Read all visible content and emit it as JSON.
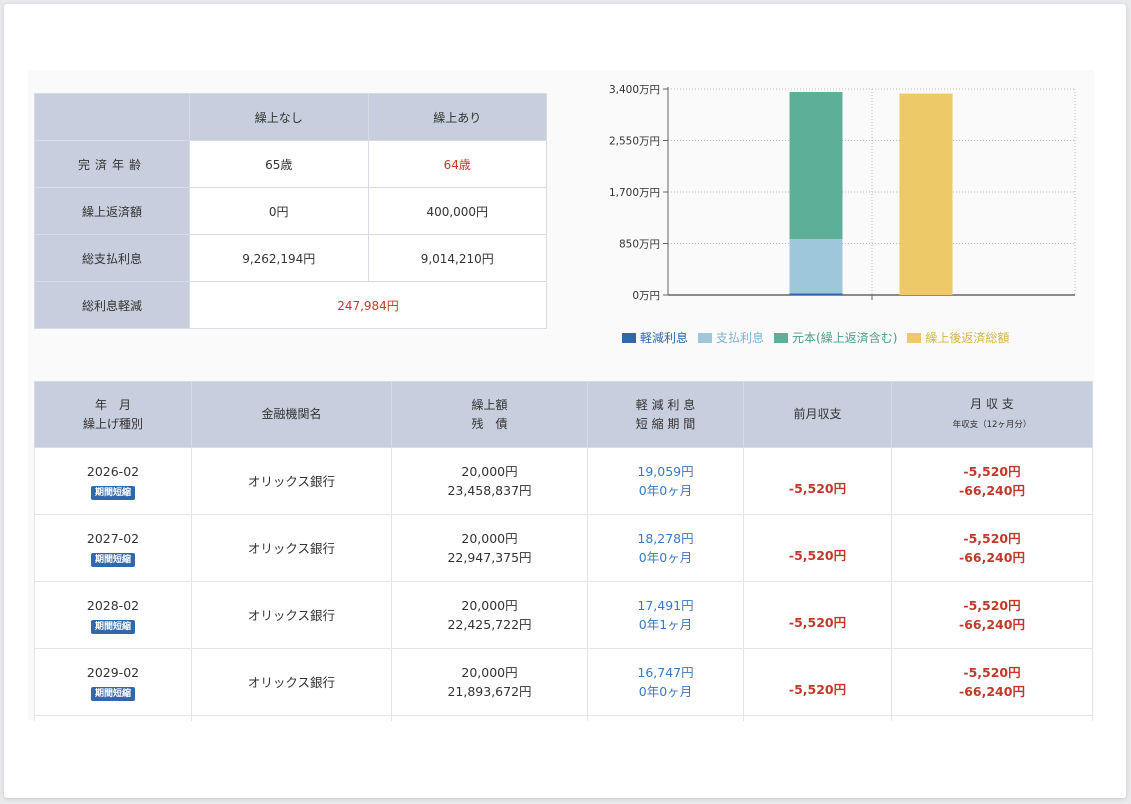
{
  "summary": {
    "col_none": "繰上なし",
    "col_with": "繰上あり",
    "rows": [
      {
        "label": "完済年齢",
        "none": "65歳",
        "with": "64歳"
      },
      {
        "label": "繰上返済額",
        "none": "0円",
        "with": "400,000円"
      },
      {
        "label": "総支払利息",
        "none": "9,262,194円",
        "with": "9,014,210円"
      }
    ],
    "reduction_label": "総利息軽減",
    "reduction_value": "247,984円"
  },
  "chart_data": {
    "type": "bar",
    "stacked": true,
    "categories": [
      "",
      ""
    ],
    "y_ticks": [
      "3,400万円",
      "2,550万円",
      "1,700万円",
      "850万円",
      "0万円"
    ],
    "ylim": [
      0,
      3400
    ],
    "series": [
      {
        "name": "軽減利息",
        "color": "#2f68ad",
        "values": [
          25,
          0
        ]
      },
      {
        "name": "支払利息",
        "color": "#9fc7dc",
        "values": [
          900,
          0
        ]
      },
      {
        "name": "元本(繰上返済含む)",
        "color": "#5daf97",
        "values": [
          2425,
          0
        ]
      },
      {
        "name": "繰上後返済総額",
        "color": "#edc967",
        "values": [
          0,
          3325
        ]
      }
    ],
    "grid": true,
    "legend": "bottom"
  },
  "detail": {
    "headers": {
      "ym_line1": "年　月",
      "ym_line2": "繰上げ種別",
      "bank": "金融機関名",
      "amount_line1": "繰上額",
      "amount_line2": "残　債",
      "interest_line1": "軽 減 利 息",
      "interest_line2": "短 縮 期 間",
      "prev": "前月収支",
      "month_line1": "月 収 支",
      "month_line2": "年収支（12ヶ月分）"
    },
    "rows": [
      {
        "date": "2026-02",
        "type": "期間短縮",
        "bank": "オリックス銀行",
        "amount": "20,000円",
        "balance": "23,458,837円",
        "interest": "19,059円",
        "period": "0年0ヶ月",
        "prev": "-5,520円",
        "month": "-5,520円",
        "year": "-66,240円"
      },
      {
        "date": "2027-02",
        "type": "期間短縮",
        "bank": "オリックス銀行",
        "amount": "20,000円",
        "balance": "22,947,375円",
        "interest": "18,278円",
        "period": "0年0ヶ月",
        "prev": "-5,520円",
        "month": "-5,520円",
        "year": "-66,240円"
      },
      {
        "date": "2028-02",
        "type": "期間短縮",
        "bank": "オリックス銀行",
        "amount": "20,000円",
        "balance": "22,425,722円",
        "interest": "17,491円",
        "period": "0年1ヶ月",
        "prev": "-5,520円",
        "month": "-5,520円",
        "year": "-66,240円"
      },
      {
        "date": "2029-02",
        "type": "期間短縮",
        "bank": "オリックス銀行",
        "amount": "20,000円",
        "balance": "21,893,672円",
        "interest": "16,747円",
        "period": "0年0ヶ月",
        "prev": "-5,520円",
        "month": "-5,520円",
        "year": "-66,240円"
      }
    ]
  }
}
